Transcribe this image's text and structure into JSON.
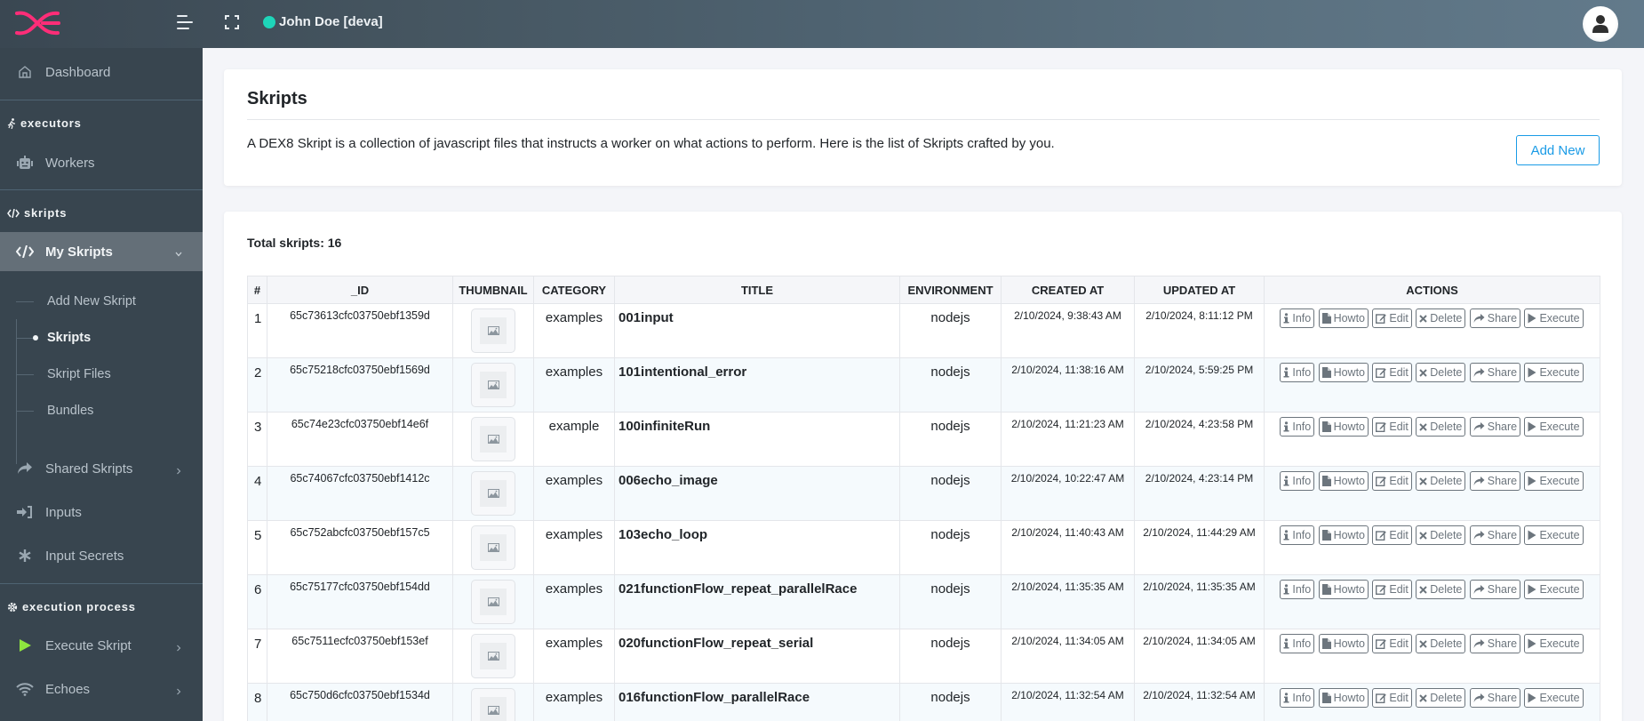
{
  "header": {
    "user_name": "John Doe [deva]",
    "status_color": "#1ed5b9",
    "logo_color": "#ff2d78",
    "icons": {
      "logo": "dex8-logo-icon",
      "menu": "hamburger-menu-icon",
      "fullscreen": "fullscreen-icon",
      "avatar": "user-avatar-icon"
    }
  },
  "sidebar": {
    "dashboard": "Dashboard",
    "sections": {
      "executors": "executors",
      "skripts": "skripts",
      "execution": "execution process"
    },
    "items": {
      "workers": "Workers",
      "my_skripts": "My Skripts",
      "shared_skripts": "Shared Skripts",
      "inputs": "Inputs",
      "input_secrets": "Input Secrets",
      "execute_skript": "Execute Skript",
      "echoes": "Echoes"
    },
    "submenu": [
      {
        "label": "Add New Skript",
        "active": false
      },
      {
        "label": "Skripts",
        "active": true
      },
      {
        "label": "Skript Files",
        "active": false
      },
      {
        "label": "Bundles",
        "active": false
      }
    ],
    "execute_icon_color": "#8ee53f"
  },
  "page": {
    "title": "Skripts",
    "description": "A DEX8 Skript is a collection of javascript files that instructs a worker on what actions to perform. Here is the list of Skripts crafted by you.",
    "add_new_label": "Add New",
    "accent_color": "#1a9be6",
    "total_label": "Total skripts: 16"
  },
  "table": {
    "columns": [
      "#",
      "_ID",
      "THUMBNAIL",
      "CATEGORY",
      "TITLE",
      "ENVIRONMENT",
      "CREATED AT",
      "UPDATED AT",
      "ACTIONS"
    ],
    "actions": [
      "Info",
      "Howto",
      "Edit",
      "Delete",
      "Share",
      "Execute"
    ],
    "rows": [
      {
        "num": "1",
        "id": "65c73613cfc03750ebf1359d",
        "category": "examples",
        "title": "001input",
        "environment": "nodejs",
        "created": "2/10/2024, 9:38:43 AM",
        "updated": "2/10/2024, 8:11:12 PM"
      },
      {
        "num": "2",
        "id": "65c75218cfc03750ebf1569d",
        "category": "examples",
        "title": "101intentional_error",
        "environment": "nodejs",
        "created": "2/10/2024, 11:38:16 AM",
        "updated": "2/10/2024, 5:59:25 PM"
      },
      {
        "num": "3",
        "id": "65c74e23cfc03750ebf14e6f",
        "category": "example",
        "title": "100infiniteRun",
        "environment": "nodejs",
        "created": "2/10/2024, 11:21:23 AM",
        "updated": "2/10/2024, 4:23:58 PM"
      },
      {
        "num": "4",
        "id": "65c74067cfc03750ebf1412c",
        "category": "examples",
        "title": "006echo_image",
        "environment": "nodejs",
        "created": "2/10/2024, 10:22:47 AM",
        "updated": "2/10/2024, 4:23:14 PM"
      },
      {
        "num": "5",
        "id": "65c752abcfc03750ebf157c5",
        "category": "examples",
        "title": "103echo_loop",
        "environment": "nodejs",
        "created": "2/10/2024, 11:40:43 AM",
        "updated": "2/10/2024, 11:44:29 AM"
      },
      {
        "num": "6",
        "id": "65c75177cfc03750ebf154dd",
        "category": "examples",
        "title": "021functionFlow_repeat_parallelRace",
        "environment": "nodejs",
        "created": "2/10/2024, 11:35:35 AM",
        "updated": "2/10/2024, 11:35:35 AM"
      },
      {
        "num": "7",
        "id": "65c7511ecfc03750ebf153ef",
        "category": "examples",
        "title": "020functionFlow_repeat_serial",
        "environment": "nodejs",
        "created": "2/10/2024, 11:34:05 AM",
        "updated": "2/10/2024, 11:34:05 AM"
      },
      {
        "num": "8",
        "id": "65c750d6cfc03750ebf1534d",
        "category": "examples",
        "title": "016functionFlow_parallelRace",
        "environment": "nodejs",
        "created": "2/10/2024, 11:32:54 AM",
        "updated": "2/10/2024, 11:32:54 AM"
      }
    ]
  }
}
